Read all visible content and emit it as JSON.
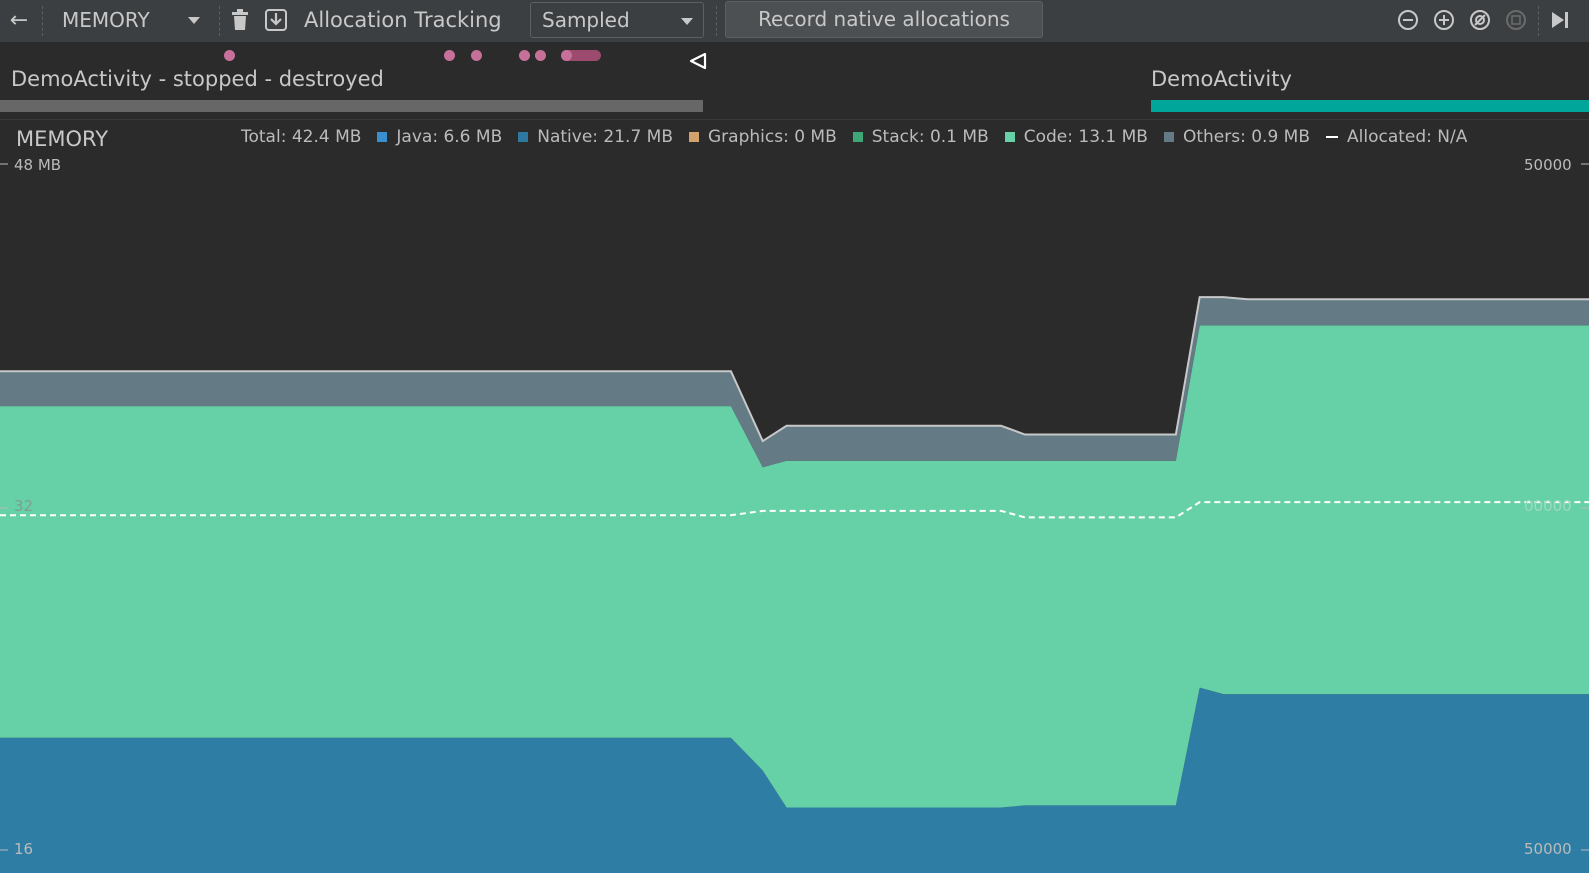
{
  "toolbar": {
    "back_icon": "arrow-left-icon",
    "profiler_select": "MEMORY",
    "delete_icon": "trash-icon",
    "export_icon": "save-icon",
    "allocation_tracking_label": "Allocation Tracking",
    "allocation_mode": "Sampled",
    "record_button": "Record native allocations",
    "zoom_out_icon": "zoom-out-icon",
    "zoom_in_icon": "zoom-in-icon",
    "reset_zoom_icon": "reset-zoom-icon",
    "zoom_to_selection_icon": "zoom-to-selection-icon",
    "go_live_icon": "skip-to-end-icon"
  },
  "events": {
    "activities": [
      {
        "label": "DemoActivity - stopped - destroyed",
        "state": "stopped",
        "color": "#676767"
      },
      {
        "label": "DemoActivity",
        "state": "active",
        "color": "#00a69a"
      }
    ],
    "event_marker_color": "#c7719a"
  },
  "memory": {
    "title": "MEMORY",
    "legend": [
      {
        "label": "Total: 42.4 MB",
        "color": null,
        "kind": "text"
      },
      {
        "label": "Java: 6.6 MB",
        "color": "#3a8fcf",
        "kind": "swatch"
      },
      {
        "label": "Native: 21.7 MB",
        "color": "#2e79a2",
        "kind": "swatch"
      },
      {
        "label": "Graphics: 0 MB",
        "color": "#d1a26b",
        "kind": "swatch"
      },
      {
        "label": "Stack: 0.1 MB",
        "color": "#3da876",
        "kind": "swatch"
      },
      {
        "label": "Code: 13.1 MB",
        "color": "#66d1a6",
        "kind": "swatch"
      },
      {
        "label": "Others: 0.9 MB",
        "color": "#647a85",
        "kind": "swatch"
      },
      {
        "label": "Allocated: N/A",
        "color": "#ffffff",
        "kind": "dash"
      }
    ],
    "y_left": {
      "top": "48 MB",
      "mid": "32",
      "bottom": "16"
    },
    "y_right": {
      "top": "50000",
      "mid": "00000",
      "bottom": "50000"
    }
  },
  "chart_data": {
    "type": "area",
    "x": [
      0,
      46,
      48,
      49.5,
      63,
      64.5,
      74,
      75.5,
      77,
      78.5,
      100
    ],
    "series": [
      {
        "name": "Native",
        "values": [
          21.7,
          21.7,
          20.2,
          18.5,
          18.5,
          18.6,
          18.6,
          24.0,
          23.7,
          23.7,
          23.7
        ]
      },
      {
        "name": "Code",
        "values": [
          15.2,
          15.2,
          13.9,
          15.9,
          15.9,
          15.8,
          15.8,
          16.6,
          16.9,
          16.9,
          16.9
        ]
      },
      {
        "name": "Others",
        "values": [
          1.6,
          1.6,
          1.2,
          1.6,
          1.6,
          1.2,
          1.2,
          1.3,
          1.3,
          1.2,
          1.2
        ]
      }
    ],
    "allocated": [
      31.9,
      31.9,
      32.1,
      32.1,
      32.1,
      31.8,
      31.8,
      32.5,
      32.5,
      32.5,
      32.5
    ],
    "ylim": [
      15.5,
      48
    ],
    "colors": {
      "Native": "#2e7da4",
      "Code": "#66d1a6",
      "Others": "#647a85"
    },
    "total_line_color": "#c8c8c8",
    "allocated_line_color": "#ffffff"
  }
}
